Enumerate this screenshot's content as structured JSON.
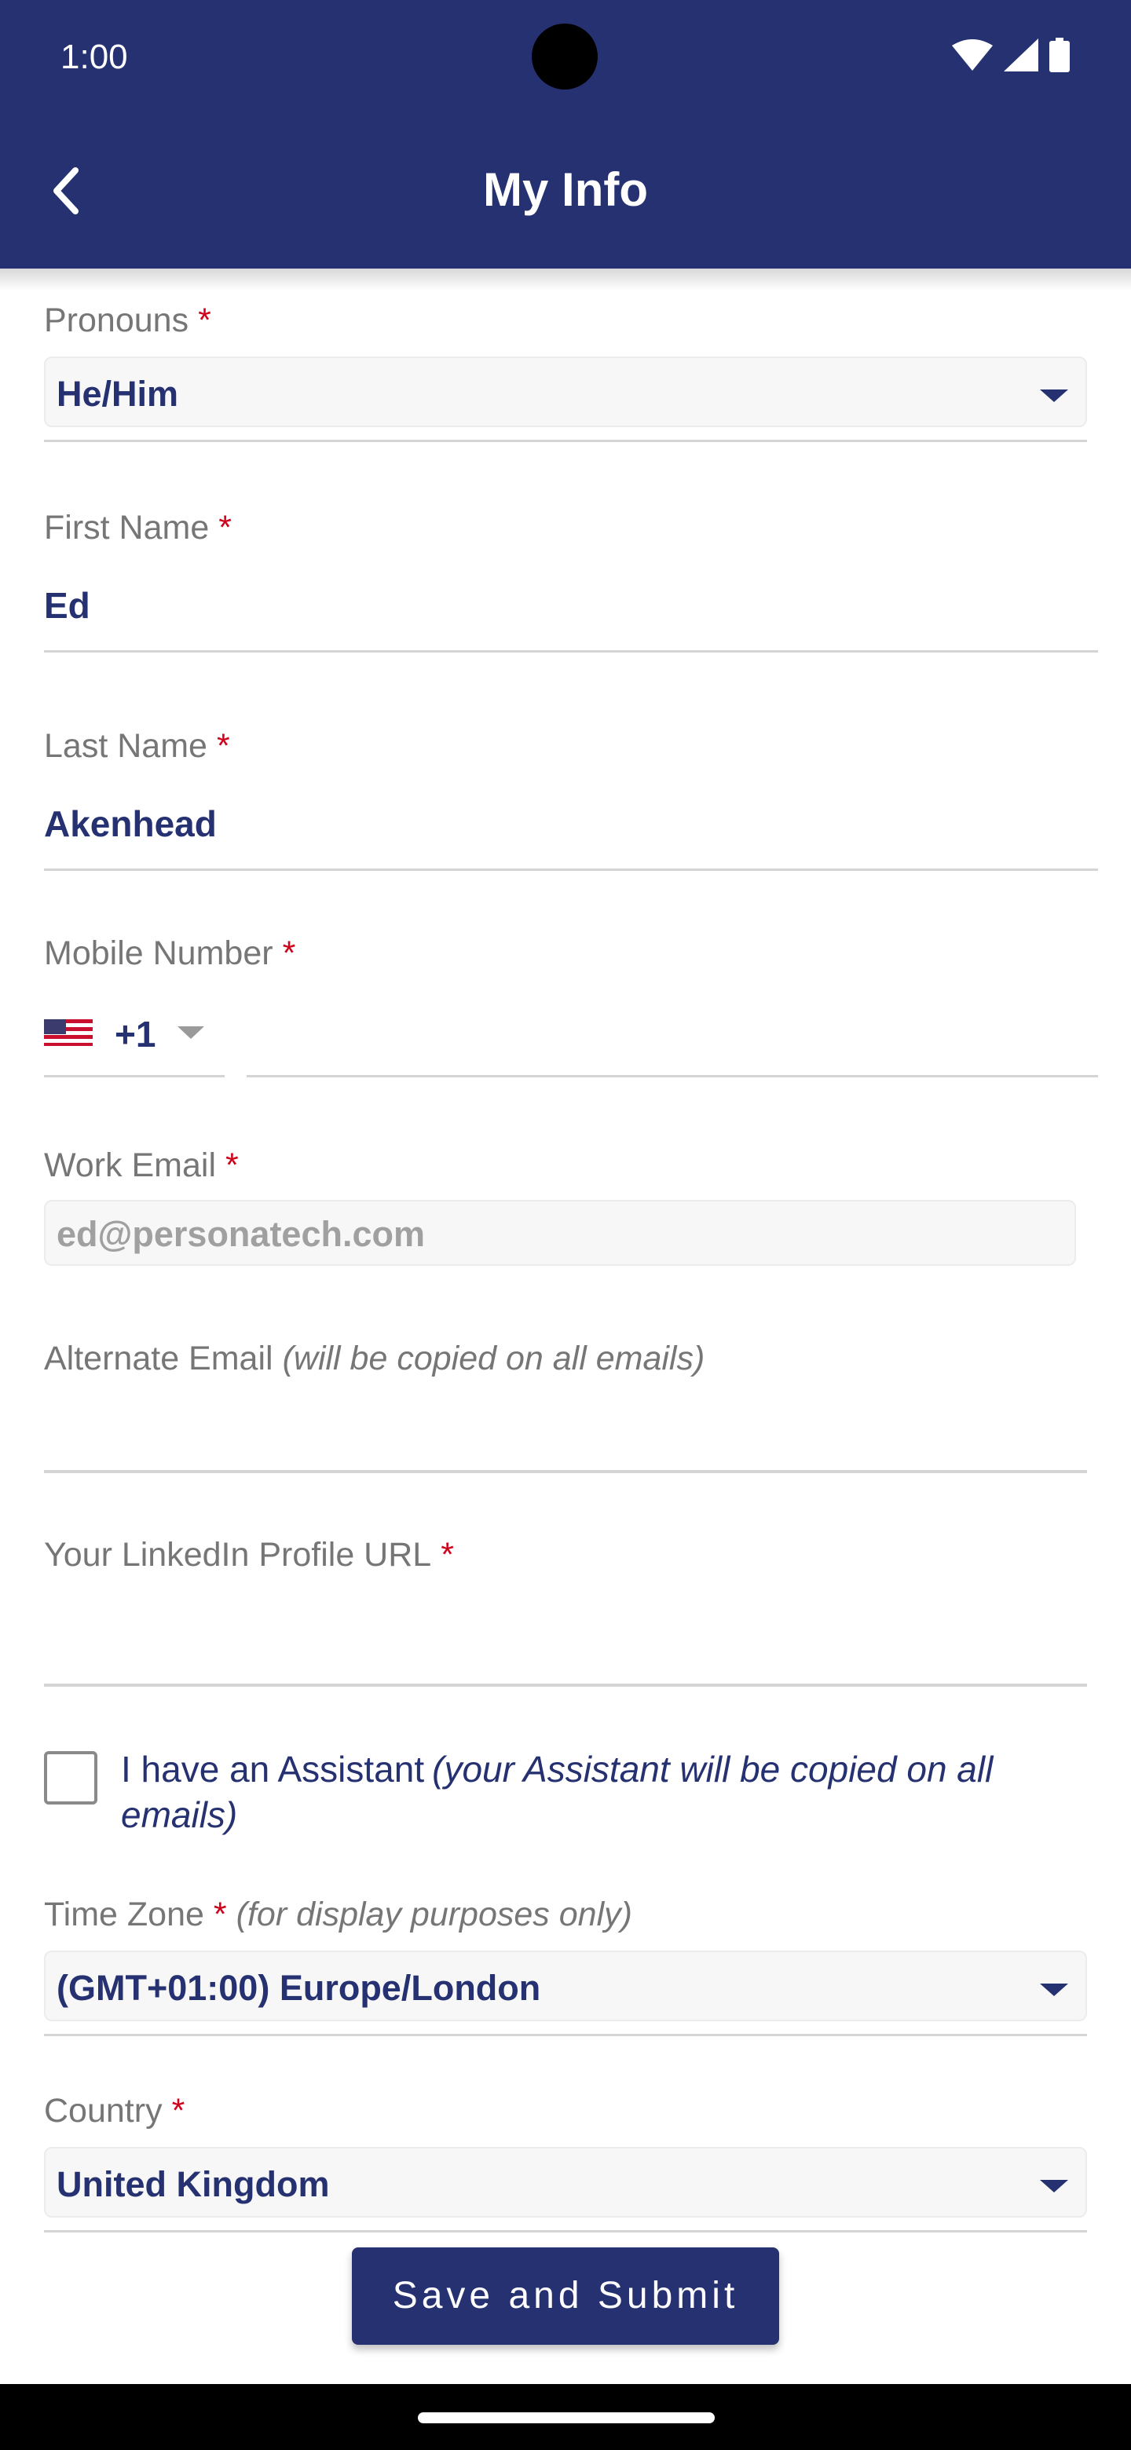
{
  "status_bar": {
    "time": "1:00",
    "icons": [
      "wifi-icon",
      "signal-icon",
      "battery-icon"
    ]
  },
  "header": {
    "title": "My Info",
    "back_icon": "chevron-left-icon"
  },
  "form": {
    "pronouns": {
      "label": "Pronouns",
      "required_mark": "*",
      "value": "He/Him"
    },
    "first_name": {
      "label": "First Name",
      "required_mark": "*",
      "value": "Ed"
    },
    "last_name": {
      "label": "Last Name",
      "required_mark": "*",
      "value": "Akenhead"
    },
    "mobile": {
      "label": "Mobile Number",
      "required_mark": "*",
      "country_flag": "us-flag-icon",
      "dial_code": "+1",
      "value": ""
    },
    "work_email": {
      "label": "Work Email",
      "required_mark": "*",
      "value": "ed@personatech.com"
    },
    "alternate_email": {
      "label": "Alternate Email",
      "hint": "(will be copied on all emails)",
      "value": ""
    },
    "linkedin": {
      "label": "Your LinkedIn Profile URL",
      "required_mark": "*",
      "value": ""
    },
    "assistant": {
      "label": "I have an Assistant",
      "hint": "(your Assistant will be copied on all emails)",
      "checked": false
    },
    "time_zone": {
      "label": "Time Zone",
      "required_mark": "*",
      "hint": "(for display purposes only)",
      "value": "(GMT+01:00) Europe/London"
    },
    "country": {
      "label": "Country",
      "required_mark": "*",
      "value": "United Kingdom"
    }
  },
  "actions": {
    "submit_label": "Save and Submit"
  },
  "colors": {
    "primary": "#253170",
    "required": "#d0021b",
    "label": "#767676"
  }
}
